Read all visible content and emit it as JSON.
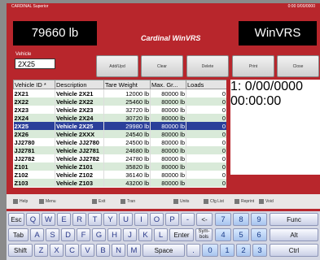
{
  "header": {
    "top_left": "CARDINAL Superior",
    "top_right": "0:00 0/00/0000",
    "weight": "79660 lb",
    "brand": "WinVRS",
    "logo": "Cardinal WinVRS"
  },
  "vehicle": {
    "label": "Vehicle",
    "value": "2X25"
  },
  "top_buttons": [
    "Add/Upd",
    "Clear",
    "Delete",
    "Print",
    "Close"
  ],
  "grid": {
    "columns": [
      "Vehicle ID *",
      "Description",
      "Tare Weight",
      "Max. Gr...",
      "Loads"
    ],
    "rows": [
      [
        "2X21",
        "Vehicle 2X21",
        "12000 lb",
        "80000 lb",
        "0"
      ],
      [
        "2X22",
        "Vehicle 2X22",
        "25460 lb",
        "80000 lb",
        "0"
      ],
      [
        "2X23",
        "Vehicle 2X23",
        "32720 lb",
        "80000 lb",
        "0"
      ],
      [
        "2X24",
        "Vehicle 2X24",
        "30720 lb",
        "80000 lb",
        "0"
      ],
      [
        "2X25",
        "Vehicle 2X25",
        "29980 lb",
        "80000 lb",
        "0"
      ],
      [
        "2X26",
        "Vehicle 2XXX",
        "24540 lb",
        "80000 lb",
        "0"
      ],
      [
        "JJ2780",
        "Vehicle JJ2780",
        "24500 lb",
        "80000 lb",
        "0"
      ],
      [
        "JJ2781",
        "Vehicle JJ2781",
        "24680 lb",
        "80000 lb",
        "0"
      ],
      [
        "JJ2782",
        "Vehicle JJ2782",
        "24780 lb",
        "80000 lb",
        "0"
      ],
      [
        "Z101",
        "Vehicle Z101",
        "35820 lb",
        "80000 lb",
        "0"
      ],
      [
        "Z102",
        "Vehicle Z102",
        "36140 lb",
        "80000 lb",
        "0"
      ],
      [
        "Z103",
        "Vehicle Z103",
        "43200 lb",
        "80000 lb",
        "0"
      ]
    ],
    "selected_index": 4
  },
  "photo_caption": "1: 0/00/0000 00:00:00",
  "toolbar": [
    "Help",
    "Menu",
    "Exit",
    "Tran",
    "Units",
    "Cfg List",
    "Reprint",
    "Void"
  ],
  "keyboard": {
    "row1": [
      "Esc",
      "Q",
      "W",
      "E",
      "R",
      "T",
      "Y",
      "U",
      "I",
      "O",
      "P",
      "-",
      "<-",
      "7",
      "8",
      "9",
      "Func"
    ],
    "row2": [
      "Tab",
      "A",
      "S",
      "D",
      "F",
      "G",
      "H",
      "J",
      "K",
      "L",
      "Enter",
      "Sym-bols",
      "4",
      "5",
      "6",
      "Alt"
    ],
    "row3": [
      "Shift",
      "Z",
      "X",
      "C",
      "V",
      "B",
      "N",
      "M",
      "Space",
      ".",
      "0",
      "1",
      "2",
      "3",
      "Ctrl"
    ]
  }
}
